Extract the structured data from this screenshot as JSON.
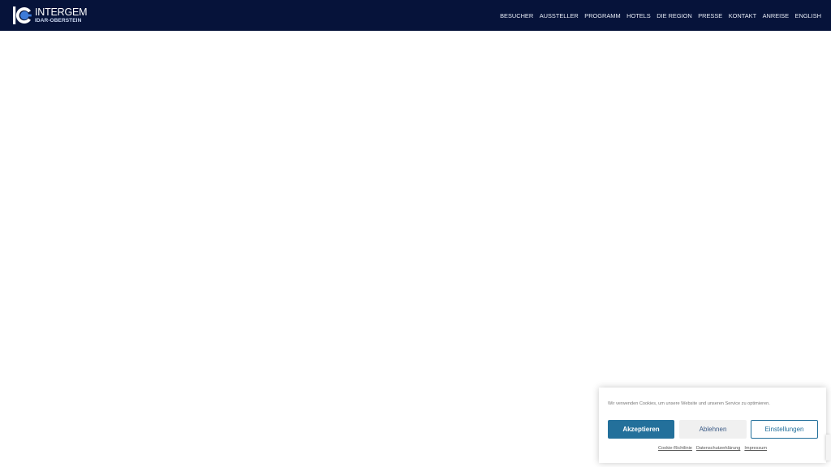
{
  "header": {
    "logo": {
      "name": "INTERGEM",
      "subtitle": "IDAR-OBERSTEIN",
      "mark_letters": "IG",
      "colors": {
        "mark_white": "#ffffff",
        "mark_blue": "#3d7bd8"
      }
    },
    "background_color": "#06133a",
    "nav": [
      {
        "label": "BESUCHER"
      },
      {
        "label": "AUSSTELLER"
      },
      {
        "label": "PROGRAMM"
      },
      {
        "label": "HOTELS"
      },
      {
        "label": "DIE REGION"
      },
      {
        "label": "PRESSE"
      },
      {
        "label": "KONTAKT"
      },
      {
        "label": "ANREISE"
      },
      {
        "label": "ENGLISH"
      }
    ]
  },
  "cookie_banner": {
    "message": "Wir verwenden Cookies, um unsere Website und unseren Service zu optimieren.",
    "accept_label": "Akzeptieren",
    "deny_label": "Ablehnen",
    "settings_label": "Einstellungen",
    "links": [
      {
        "label": "Cookie-Richtlinie"
      },
      {
        "label": "Datenschutzerklärung"
      },
      {
        "label": "Impressum"
      }
    ],
    "colors": {
      "accent": "#23709b",
      "deny_bg": "#f0f0f0"
    }
  }
}
